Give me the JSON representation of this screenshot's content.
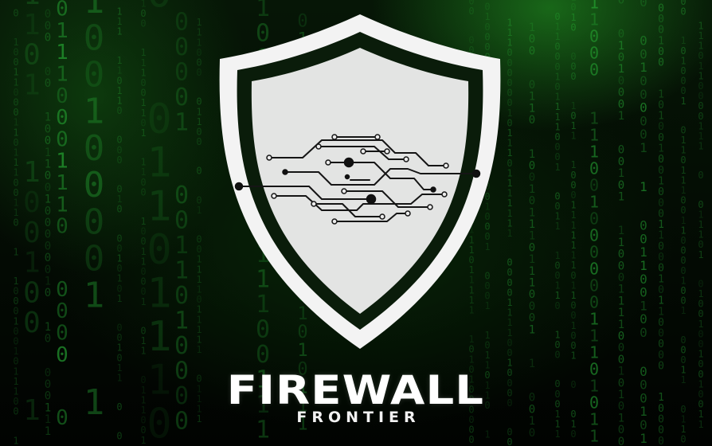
{
  "logo": {
    "title": "FIREWALL",
    "subtitle": "FRONTIER"
  },
  "colors": {
    "background": "#030a03",
    "code_rain": "#2ecc40",
    "shield": "#f0f0f0",
    "circuit": "#111111",
    "text": "#ffffff"
  },
  "icons": {
    "emblem": "shield-circuit-icon",
    "background": "binary-code-rain"
  }
}
